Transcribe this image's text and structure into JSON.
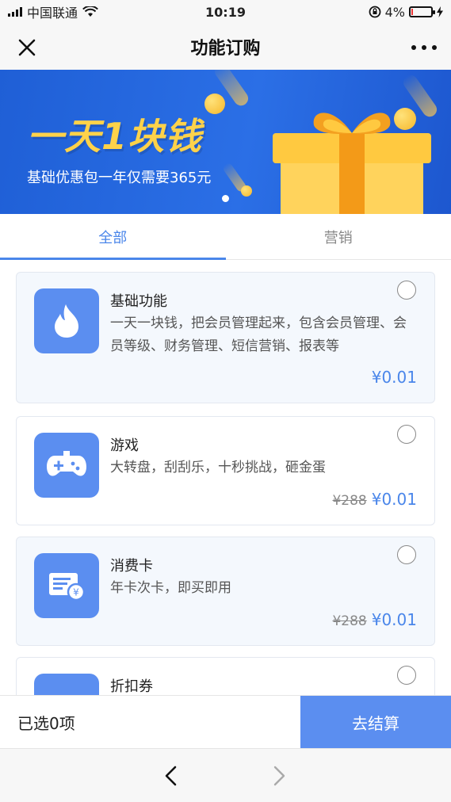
{
  "status_bar": {
    "carrier": "中国联通",
    "time": "10:19",
    "battery": "4%"
  },
  "nav": {
    "title": "功能订购"
  },
  "banner": {
    "headline": "一天1块钱",
    "subtitle": "基础优惠包一年仅需要365元"
  },
  "tabs": [
    {
      "label": "全部",
      "active": true
    },
    {
      "label": "营销",
      "active": false
    }
  ],
  "items": [
    {
      "title": "基础功能",
      "desc": "一天一块钱，把会员管理起来，包含会员管理、会员等级、财务管理、短信营销、报表等",
      "old_price": "",
      "price": "¥0.01",
      "icon": "flame-icon"
    },
    {
      "title": "游戏",
      "desc": "大转盘，刮刮乐，十秒挑战，砸金蛋",
      "old_price": "¥288",
      "price": "¥0.01",
      "icon": "gamepad-icon"
    },
    {
      "title": "消费卡",
      "desc": "年卡次卡，即买即用",
      "old_price": "¥288",
      "price": "¥0.01",
      "icon": "card-yen-icon"
    },
    {
      "title": "折扣券",
      "desc": "",
      "old_price": "",
      "price": "",
      "icon": "coupon-icon"
    }
  ],
  "footer": {
    "selected_label": "已选0项",
    "checkout_label": "去结算"
  },
  "colors": {
    "accent": "#4a86ea",
    "icon_bg": "#5b8ef0",
    "banner_blue": "#2b6fe6",
    "headline_yellow": "#ffd24a"
  }
}
